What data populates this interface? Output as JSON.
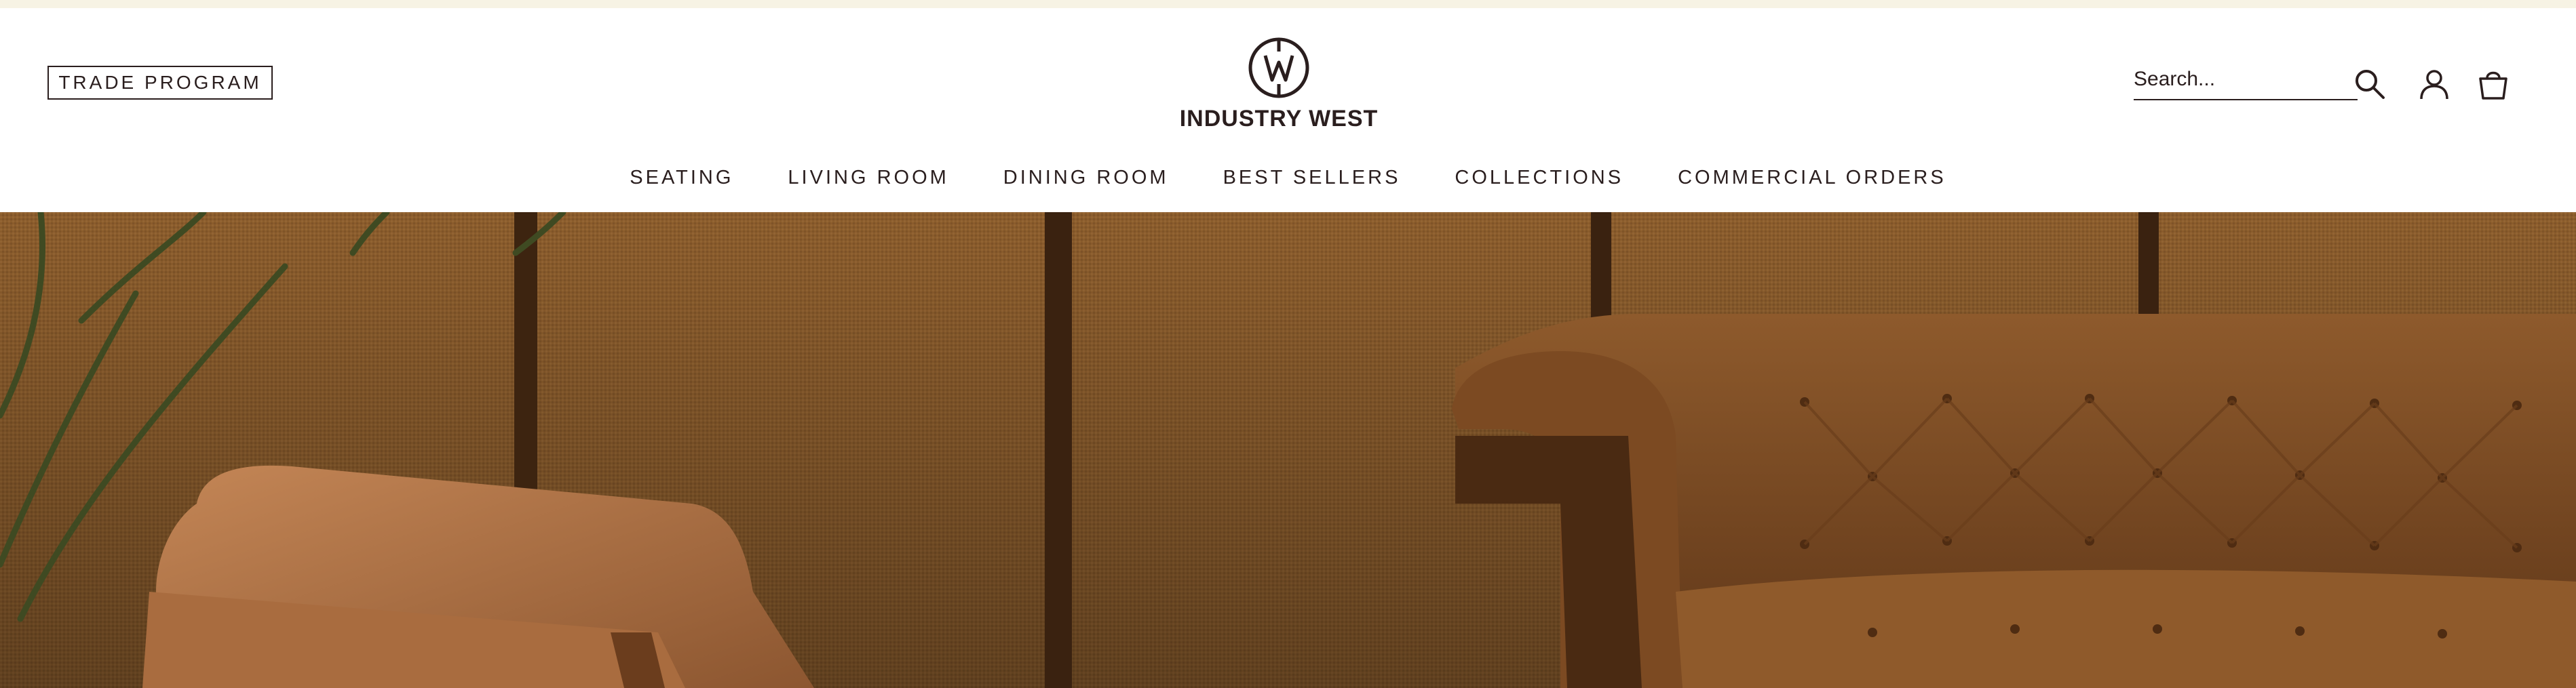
{
  "header": {
    "trade_button_label": "TRADE PROGRAM",
    "brand_name": "INDUSTRY WEST",
    "search_placeholder": "Search...",
    "nav": [
      {
        "label": "SEATING"
      },
      {
        "label": "LIVING ROOM"
      },
      {
        "label": "DINING ROOM"
      },
      {
        "label": "BEST SELLERS"
      },
      {
        "label": "COLLECTIONS"
      },
      {
        "label": "COMMERCIAL ORDERS"
      }
    ],
    "icons": [
      "logo-emblem-icon",
      "search-icon",
      "account-icon",
      "shopping-bag-icon"
    ]
  },
  "colors": {
    "announcement_bar": "#f7f3e4",
    "text": "#2a1e1e",
    "hero_wall": "#8a5a2c",
    "hero_sofa": "#7a4a22"
  }
}
